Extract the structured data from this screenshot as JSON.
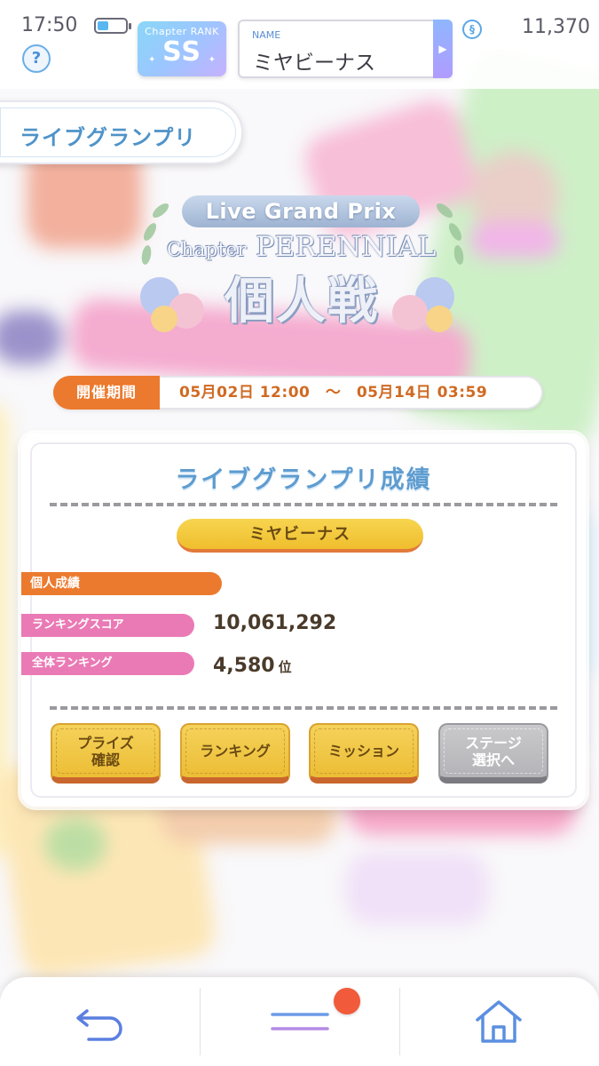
{
  "status_bar": {
    "time": "17:50",
    "help_symbol": "?",
    "currency_value": "11,370",
    "icons": [
      "battery-icon",
      "help-icon",
      "currency-icon"
    ]
  },
  "chapter_rank": {
    "label": "Chapter RANK",
    "value": "SS"
  },
  "player": {
    "name_label": "NAME",
    "name": "ミヤビーナス"
  },
  "page_title": "ライブグランプリ",
  "logo": {
    "line1": "Live Grand Prix",
    "chapter_word": "Chapter",
    "chapter_name": "PERENNIAL",
    "mode": "個人戦"
  },
  "period": {
    "label": "開催期間",
    "value": "05月02日 12:00　～　05月14日 03:59"
  },
  "results": {
    "title": "ライブグランプリ成績",
    "player_name": "ミヤビーナス",
    "section_label": "個人成績",
    "score_label": "ランキングスコア",
    "score_value": "10,061,292",
    "rank_label": "全体ランキング",
    "rank_value": "4,580",
    "rank_unit": "位"
  },
  "buttons": [
    {
      "label": "プライズ\n確認",
      "enabled": true
    },
    {
      "label": "ランキング",
      "enabled": true
    },
    {
      "label": "ミッション",
      "enabled": true
    },
    {
      "label": "ステージ\n選択へ",
      "enabled": false
    }
  ],
  "bottom_nav": {
    "items": [
      "back-icon",
      "menu-icon",
      "home-icon"
    ],
    "menu_has_notification": true
  },
  "colors": {
    "accent_blue": "#5e9cd0",
    "orange": "#ec7a2e",
    "pink": "#ea7ab5",
    "gold": "#f5d25a",
    "notification": "#f15a3a"
  }
}
